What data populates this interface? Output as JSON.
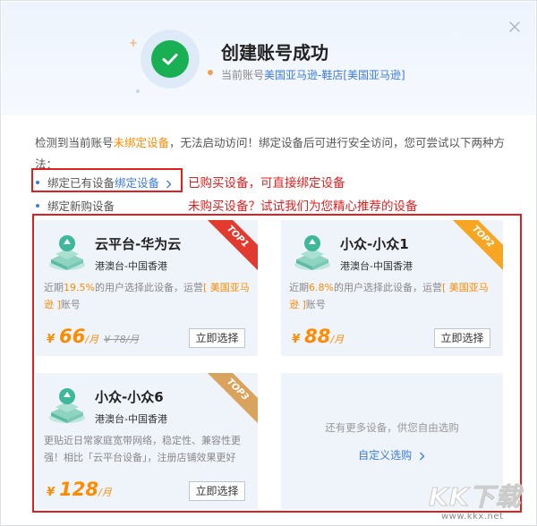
{
  "header": {
    "title": "创建账号成功",
    "subtitle_prefix": "当前账号",
    "account_name": "美国亚马逊-鞋店[美国亚马逊]",
    "close_icon": "close-icon"
  },
  "notice": {
    "part1": "检测到当前账号",
    "warning": "未绑定设备",
    "part2": "，无法启动访问！绑定设备后可进行安全访问，您可尝试以下两种方法："
  },
  "options": [
    {
      "label": "绑定已有设备",
      "link": "绑定设备",
      "icon": "chevron-right-icon"
    },
    {
      "label": "绑定新购设备"
    }
  ],
  "annotations": {
    "bind_existing": "已购买设备，可直接绑定设备",
    "recommend": "未购买设备？试试我们为您精心推荐的设备"
  },
  "cards": [
    {
      "name": "云平台-华为云",
      "region": "港澳台-中国香港",
      "rank": "TOP1",
      "desc_prefix": "近期",
      "pct": "19.5%",
      "desc_mid": "的用户选择此设备，运营",
      "operator": "[ 美国亚马逊 ]",
      "desc_suffix": "账号",
      "currency": "¥",
      "price": "66",
      "unit": "/月",
      "orig_price": "¥ 78/月",
      "button": "立即选择"
    },
    {
      "name": "小众-小众1",
      "region": "港澳台-中国香港",
      "rank": "TOP2",
      "desc_prefix": "近期",
      "pct": "6.8%",
      "desc_mid": "的用户选择此设备，运营",
      "operator": "[ 美国亚马逊 ]",
      "desc_suffix": "账号",
      "currency": "¥",
      "price": "88",
      "unit": "/月",
      "button": "立即选择"
    },
    {
      "name": "小众-小众6",
      "region": "港澳台-中国香港",
      "rank": "TOP3",
      "desc": "更贴近日常家庭宽带网络，稳定性、兼容性更强！相比「云平台设备」，注册店铺效果更好",
      "currency": "¥",
      "price": "128",
      "unit": "/月",
      "button": "立即选择"
    }
  ],
  "more": {
    "text": "还有更多设备，供您自由选购",
    "link": "自定义选购"
  },
  "watermark": {
    "logo": "KK下载",
    "url": "www.kkx.net"
  },
  "colors": {
    "accent": "#3d7bd9",
    "success": "#19b053",
    "warning": "#ff8a00",
    "annotation_red": "#e02020",
    "card_bg": "#eff4fb"
  }
}
